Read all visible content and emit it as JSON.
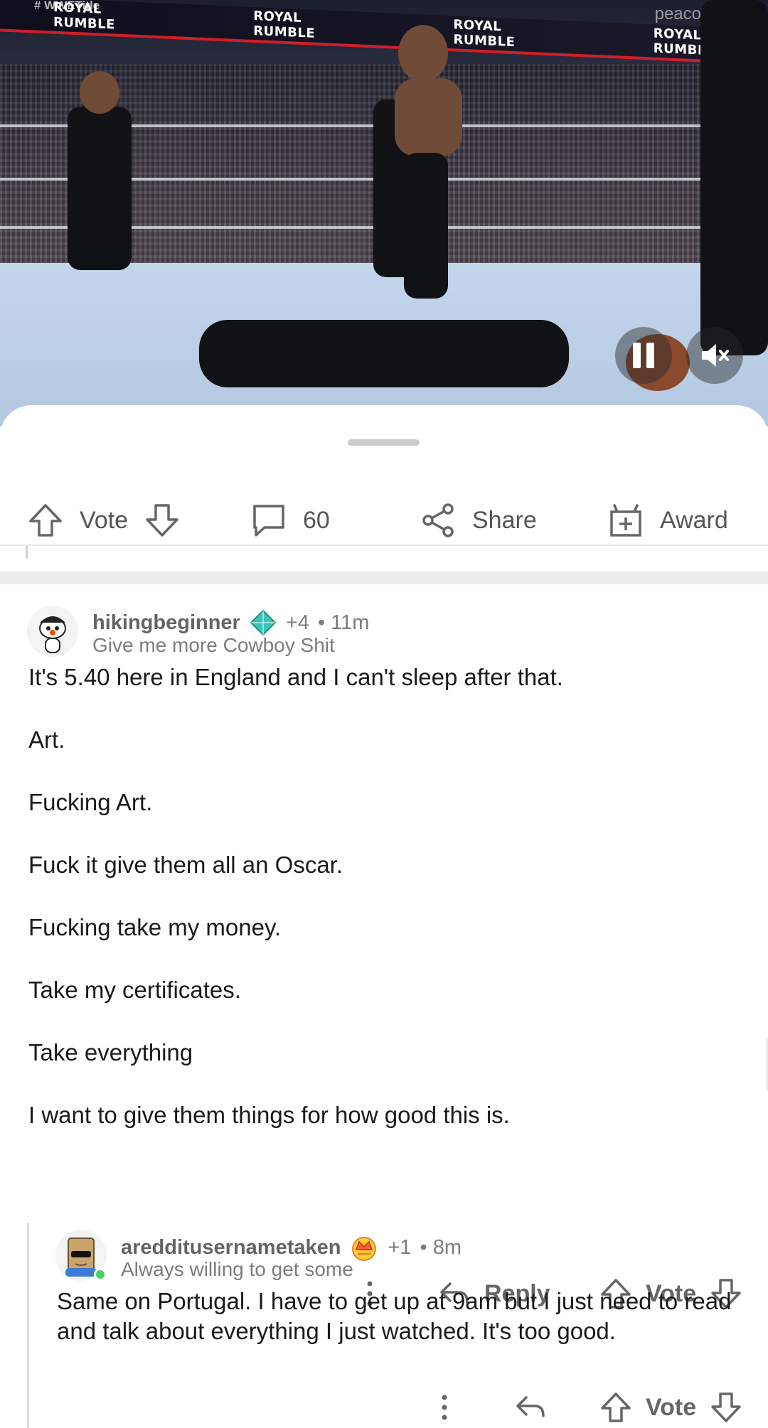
{
  "video": {
    "watermark_left": "# WWETitle",
    "watermark_right": "peacock",
    "banner_text": "ROYAL RUMBLE",
    "ring_apron_text": "ROYAL",
    "pause_icon": "pause-icon",
    "mute_icon": "mute-icon"
  },
  "actions": {
    "vote_label": "Vote",
    "comments_count": "60",
    "share_label": "Share",
    "award_label": "Award"
  },
  "comments": [
    {
      "username": "hikingbeginner",
      "karma": "+4",
      "time": "• 11m",
      "flair": "Give me more Cowboy Shit",
      "paragraphs": [
        "It's 5.40 here in England and I can't sleep after that.",
        "Art.",
        "Fucking Art.",
        "Fuck it give them all an Oscar.",
        "Fucking take my money.",
        "Take my certificates.",
        "Take everything",
        "I want to give them things for how good this is."
      ],
      "reply_label": "Reply",
      "vote_label": "Vote"
    },
    {
      "username": "aredditusernametaken",
      "karma": "+1",
      "time": "• 8m",
      "flair": "Always willing to get some",
      "paragraphs": [
        "Same on Portugal. I have to get up at 9am but I just need to read and talk about everything I just watched. It's too good."
      ],
      "vote_label": "Vote"
    }
  ],
  "colors": {
    "online": "#46d160",
    "accent_red": "#d21d2a",
    "text_primary": "#1a1a1b",
    "text_meta": "#7c7c7c"
  }
}
